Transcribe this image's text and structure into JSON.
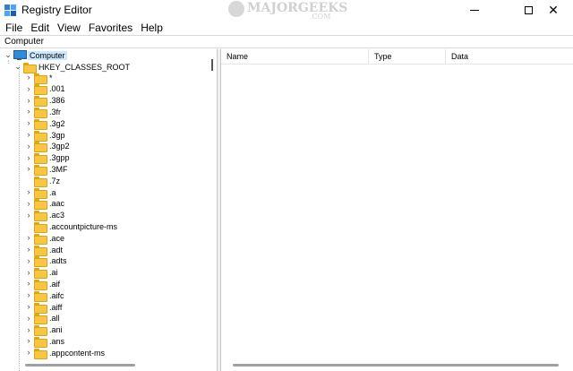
{
  "window": {
    "title": "Registry Editor",
    "watermark": "MAJORGEEKS",
    "watermark_sub": ".COM",
    "minimize_icon": "minimize-icon",
    "maximize_icon": "maximize-icon",
    "close_glyph": "✕"
  },
  "menu": {
    "items": [
      "File",
      "Edit",
      "View",
      "Favorites",
      "Help"
    ]
  },
  "address": {
    "path": "Computer"
  },
  "tree": {
    "root_chevron": "⌄",
    "root": "Computer",
    "hive_chevron": "⌄",
    "hive": "HKEY_CLASSES_ROOT",
    "child_chevron": "›",
    "children": [
      "*",
      ".001",
      ".386",
      ".3fr",
      ".3g2",
      ".3gp",
      ".3gp2",
      ".3gpp",
      ".3MF",
      ".7z",
      ".a",
      ".aac",
      ".ac3",
      ".accountpicture-ms",
      ".ace",
      ".adt",
      ".adts",
      ".ai",
      ".aif",
      ".aifc",
      ".aiff",
      ".all",
      ".ani",
      ".ans",
      ".appcontent-ms"
    ],
    "expandable": [
      true,
      true,
      true,
      true,
      true,
      true,
      true,
      true,
      true,
      false,
      true,
      true,
      true,
      false,
      true,
      true,
      true,
      true,
      true,
      true,
      true,
      true,
      true,
      true,
      true
    ]
  },
  "list": {
    "columns": [
      "Name",
      "Type",
      "Data"
    ]
  },
  "colors": {
    "selection": "#cce8ff",
    "folder": "#f6c644",
    "computer_icon": "#2e8bd8"
  }
}
